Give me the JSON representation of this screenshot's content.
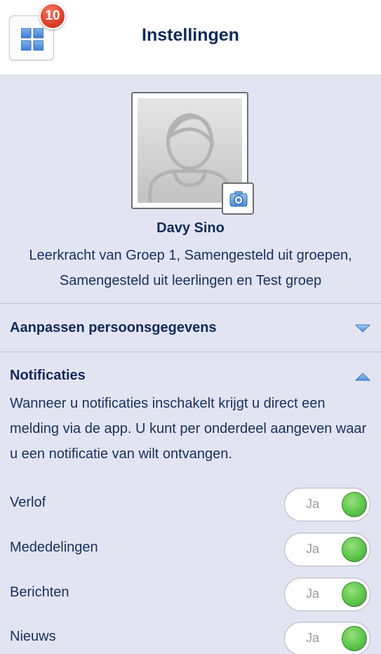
{
  "header": {
    "title": "Instellingen",
    "notification_count": "10",
    "menu_icon": "grid-icon"
  },
  "profile": {
    "name": "Davy Sino",
    "role_line1": "Leerkracht van Groep 1, Samengesteld uit groepen,",
    "role_line2": "Samengesteld uit leerlingen en Test groep",
    "camera_icon": "camera-icon"
  },
  "sections": {
    "personal": {
      "title": "Aanpassen persoonsgegevens",
      "state": "collapsed"
    },
    "notifications": {
      "title": "Notificaties",
      "state": "expanded",
      "description": "Wanneer u notificaties inschakelt krijgt u direct een melding via de app. U kunt per onderdeel aangeven waar u een notificatie van wilt ontvangen."
    }
  },
  "toggles": [
    {
      "label": "Verlof",
      "value": "Ja",
      "on": true
    },
    {
      "label": "Mededelingen",
      "value": "Ja",
      "on": true
    },
    {
      "label": "Berichten",
      "value": "Ja",
      "on": true
    },
    {
      "label": "Nieuws",
      "value": "Ja",
      "on": true
    }
  ],
  "colors": {
    "background": "#e3e4f1",
    "text": "#15305e",
    "toggle_on": "#5cc64a",
    "badge": "#e0412b",
    "accent": "#3a7fd5"
  }
}
